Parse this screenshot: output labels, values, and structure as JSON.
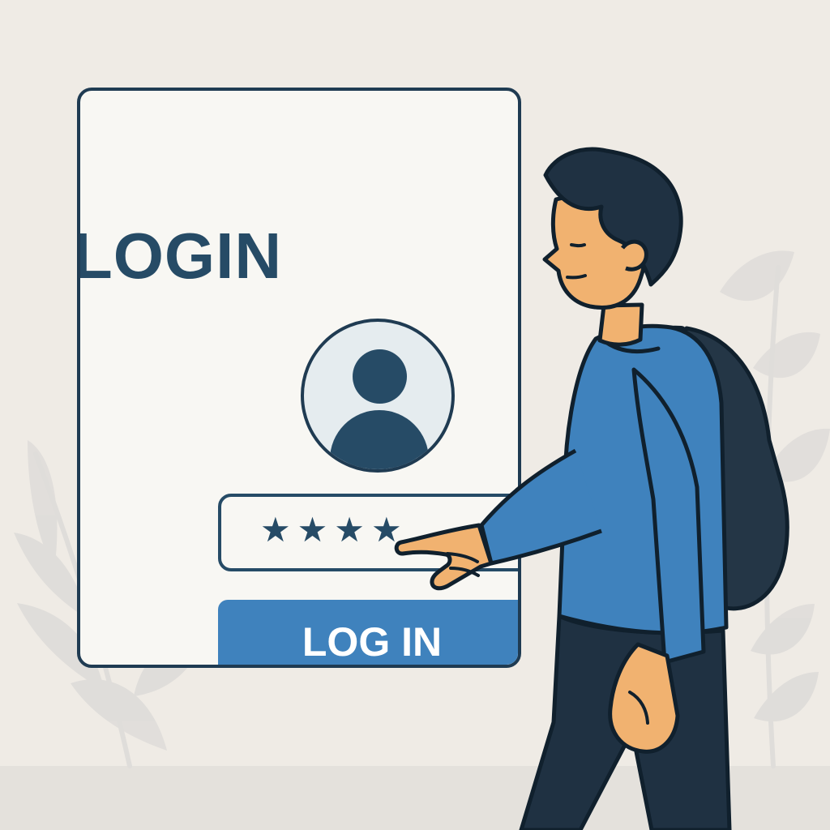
{
  "login_screen": {
    "title": "LOGIN",
    "password_field": {
      "masked_value": "★★★★"
    },
    "button": {
      "label": "LOG IN"
    },
    "avatar_icon": "user-avatar-icon"
  },
  "illustration": {
    "character": "person-pointing-illustration",
    "background_plants": "leaf-plant-icons"
  },
  "colors": {
    "background": "#efebe5",
    "panel": "#f8f7f3",
    "outline": "#1f3b52",
    "title_text": "#264b66",
    "button": "#3f82bd",
    "shirt": "#3f82bd",
    "pants": "#1f3142",
    "backpack": "#1f3142",
    "skin": "#f1b270",
    "plant": "#dfddda"
  }
}
